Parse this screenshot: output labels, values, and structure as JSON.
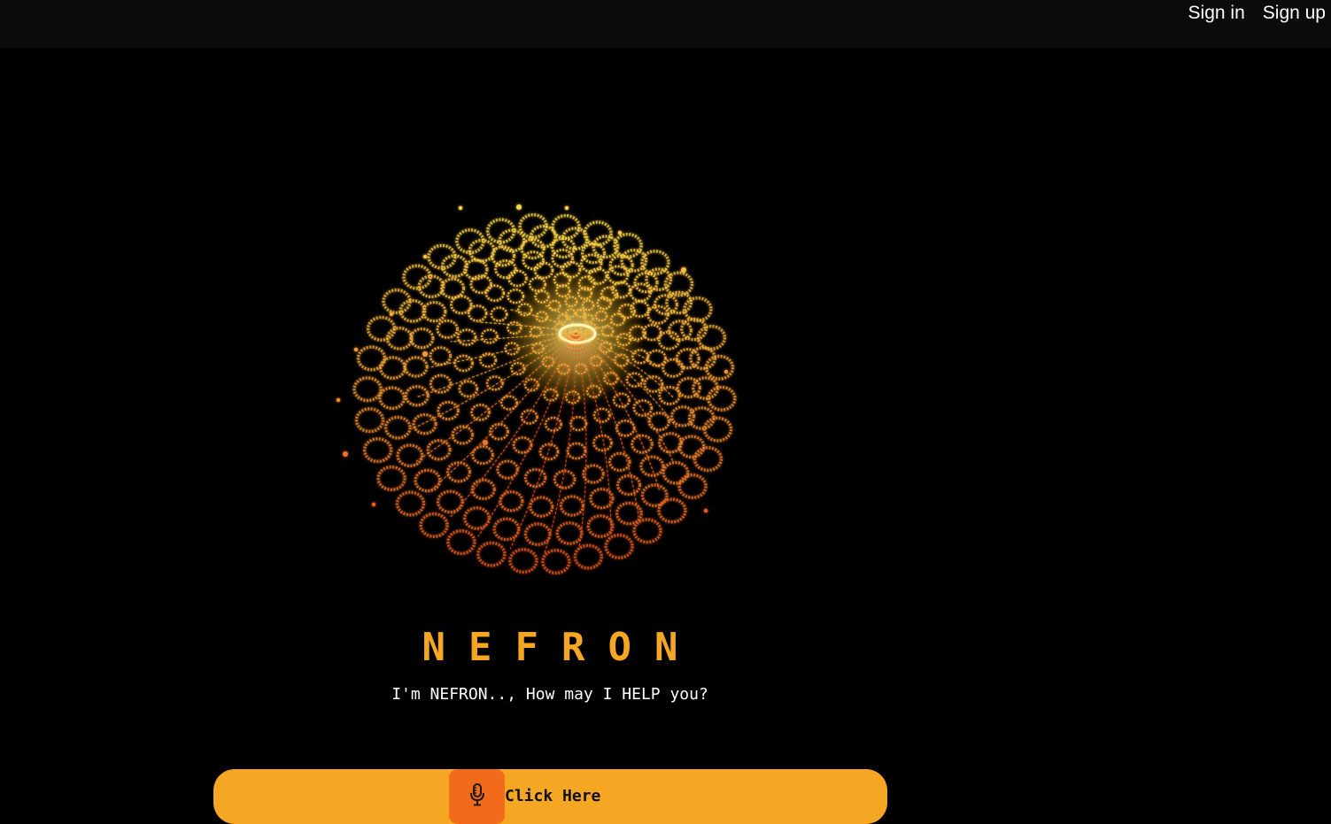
{
  "nav": {
    "sign_in": "Sign in",
    "sign_up": "Sign up"
  },
  "hero": {
    "brand": "NEFRON",
    "tagline": "I'm NEFRON.., How may I HELP you?"
  },
  "voice_bar": {
    "label": "Click Here",
    "icon": "microphone-icon"
  },
  "colors": {
    "background": "#000000",
    "topbar": "#0b0b0b",
    "accent": "#f5a623",
    "mic_button": "#f26a1b",
    "orb_bright": "#ffd84a",
    "orb_deep": "#e8501a"
  }
}
